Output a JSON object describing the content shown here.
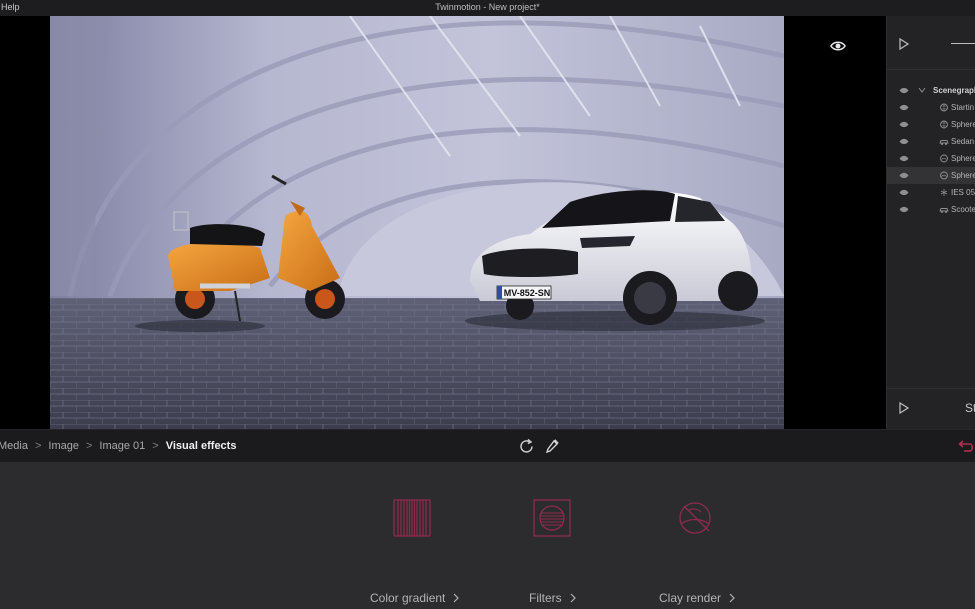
{
  "window": {
    "menu_help": "Help",
    "title": "Twinmotion - New project*"
  },
  "viewport": {
    "license_plate": "MV-852-SN",
    "eye_icon": "eye-icon"
  },
  "scenegraph": {
    "root_label": "Scenegraph",
    "items": [
      {
        "label": "Startin",
        "icon": "sphere-light-icon",
        "selected": false
      },
      {
        "label": "Sphere",
        "icon": "sphere-light-icon",
        "selected": false
      },
      {
        "label": "Sedan",
        "icon": "car-icon",
        "selected": false
      },
      {
        "label": "Sphere",
        "icon": "sphere-object-icon",
        "selected": false
      },
      {
        "label": "Sphere",
        "icon": "sphere-object-icon",
        "selected": true
      },
      {
        "label": "IES 05",
        "icon": "light-icon",
        "selected": false
      },
      {
        "label": "Scoote",
        "icon": "car-icon",
        "selected": false
      }
    ],
    "bottom_label": "St"
  },
  "breadcrumb": {
    "items": [
      "Media",
      "Image",
      "Image 01",
      "Visual effects"
    ],
    "separator": ">"
  },
  "effects": {
    "tiles": [
      {
        "label": "Color gradient",
        "icon": "color-gradient-icon"
      },
      {
        "label": "Filters",
        "icon": "filters-icon"
      },
      {
        "label": "Clay render",
        "icon": "clay-render-icon"
      }
    ]
  },
  "colors": {
    "accent": "#8f2a4a",
    "accent_bright": "#c23a5c",
    "panel_bg": "#2c2c2e",
    "bar_bg": "#1b1b1d"
  }
}
